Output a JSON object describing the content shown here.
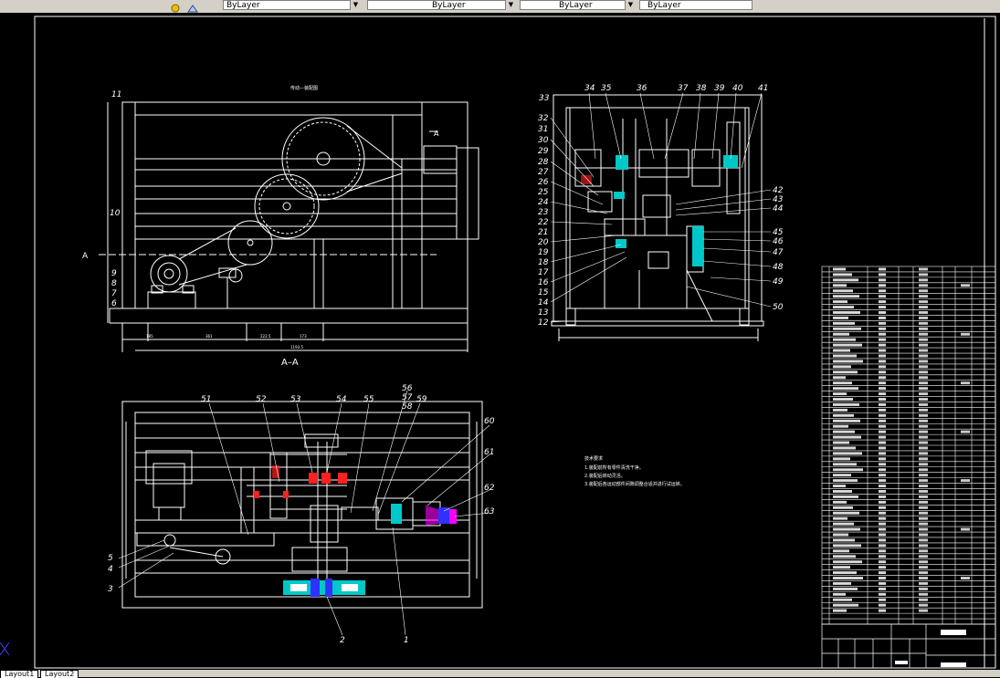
{
  "toolbar": {
    "layer_combo": "ByLayer",
    "linetype_combo": "ByLayer",
    "lineweight_combo": "ByLayer",
    "plotstyle_combo": "ByLayer"
  },
  "drawing": {
    "section_label": "A–A",
    "section_marker": "A",
    "front_view_title": "传动—装配图",
    "left_callouts": [
      "11",
      "10",
      "9",
      "8",
      "7",
      "6"
    ],
    "top_callouts": [
      "33",
      "34",
      "35",
      "36",
      "37",
      "38",
      "39",
      "40",
      "41"
    ],
    "right_side_left_callouts": [
      "32",
      "31",
      "30",
      "29",
      "28",
      "27",
      "26",
      "25",
      "24",
      "23",
      "22",
      "21",
      "20",
      "19",
      "18",
      "17",
      "16",
      "15",
      "14",
      "13",
      "12"
    ],
    "right_side_right_callouts": [
      "42",
      "43",
      "44",
      "45",
      "46",
      "47",
      "48",
      "49",
      "50"
    ],
    "plan_top_callouts": [
      "51",
      "52",
      "53",
      "54",
      "55",
      "56",
      "57",
      "58",
      "59",
      "60"
    ],
    "plan_right_callouts": [
      "61",
      "62",
      "63"
    ],
    "plan_left_callouts": [
      "5",
      "4",
      "3"
    ],
    "plan_bottom_callouts": [
      "2",
      "1"
    ],
    "tech_req_title": "技术要求",
    "tech_req_lines": [
      "1.装配前所有零件清洗干净。",
      "2.装配后转动灵活。",
      "3.装配后各运动部件间隙调整合适并进行试运转。"
    ],
    "dims_bottom": [
      "185",
      "361",
      "222.5",
      "173",
      "1193.5"
    ]
  },
  "layout_tabs": [
    "Layout1",
    "Layout2"
  ],
  "colors": {
    "white_line": "#ffffff",
    "cyan_part": "#00c8c8",
    "red_part": "#ff2020",
    "blue_part": "#3030ff",
    "magenta_part": "#ff00ff"
  }
}
